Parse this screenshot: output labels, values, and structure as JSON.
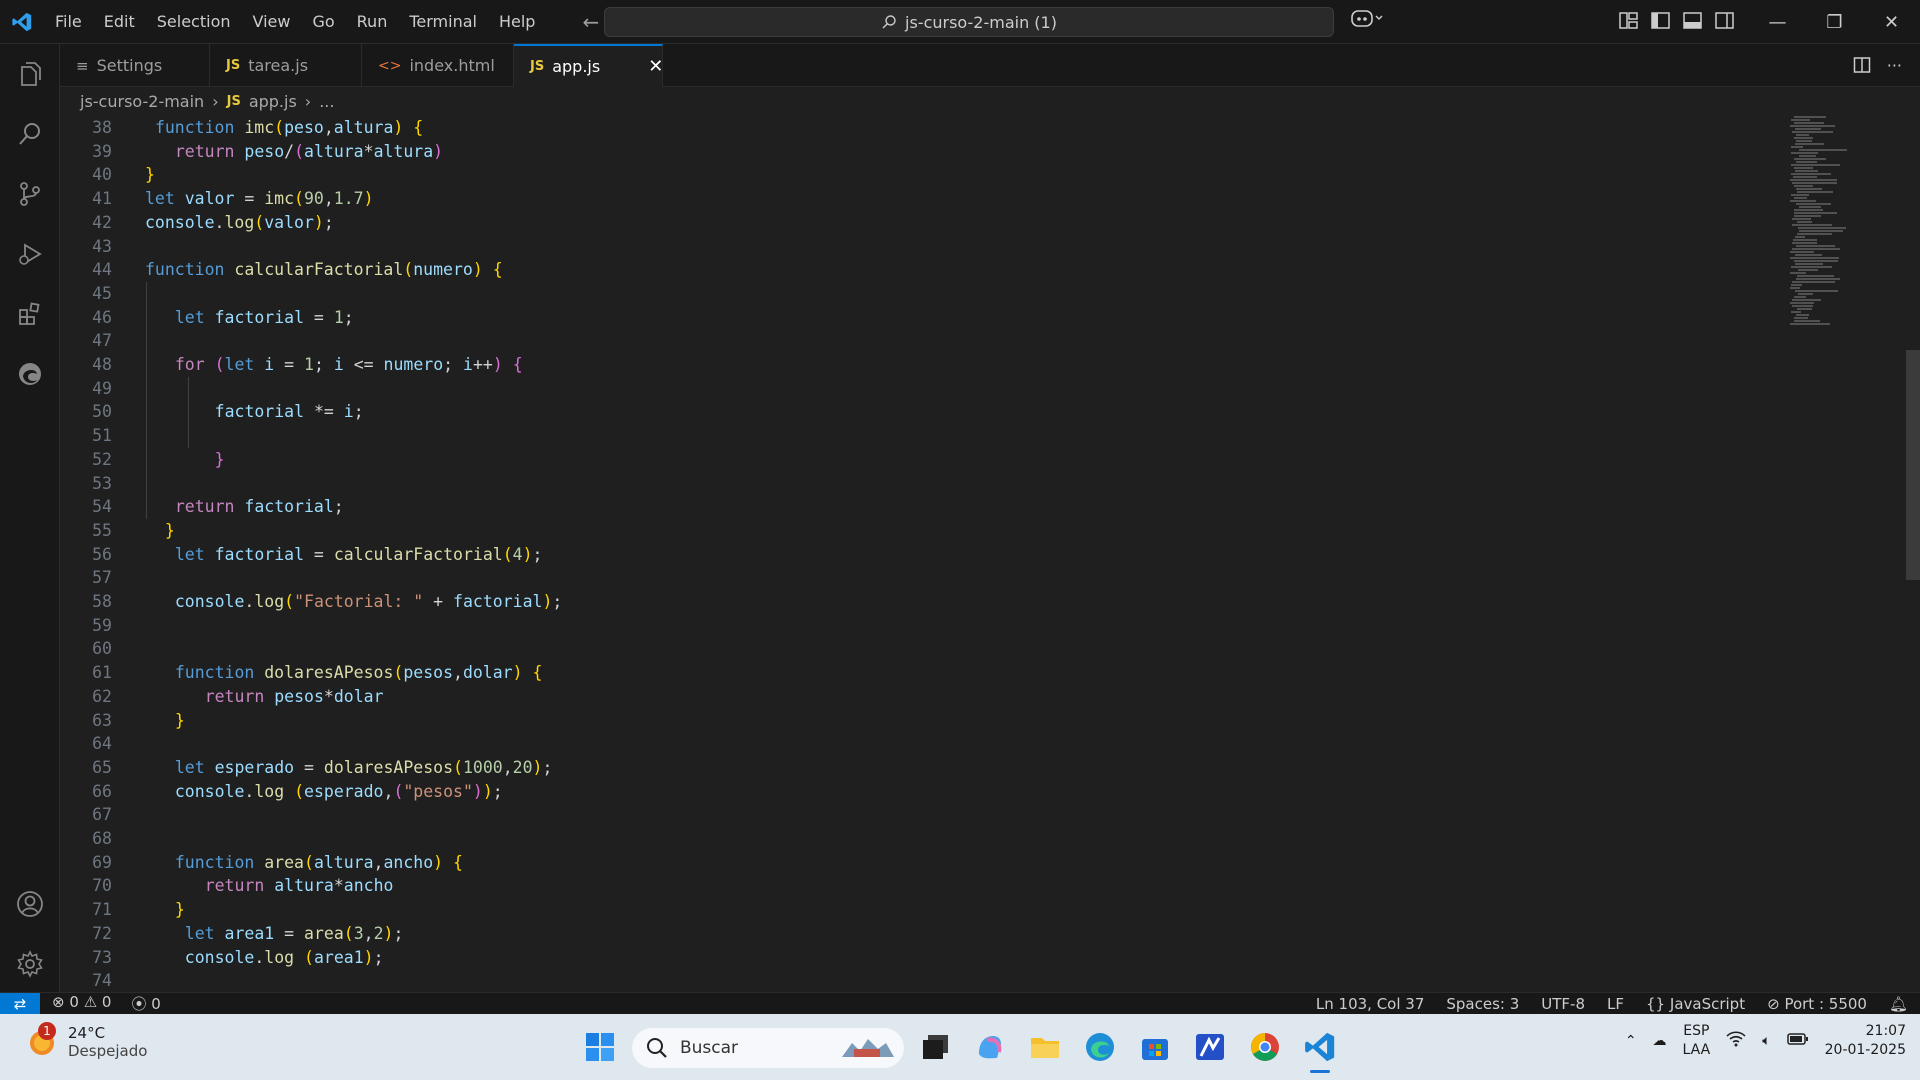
{
  "titlebar": {
    "menu": [
      "File",
      "Edit",
      "Selection",
      "View",
      "Go",
      "Run",
      "Terminal",
      "Help"
    ],
    "search": "js-curso-2-main (1)"
  },
  "tabs": [
    {
      "label": "Settings",
      "icon": "gear-icon"
    },
    {
      "label": "tarea.js",
      "icon": "js-icon"
    },
    {
      "label": "index.html",
      "icon": "html-icon"
    },
    {
      "label": "app.js",
      "icon": "js-icon",
      "active": true
    }
  ],
  "breadcrumb": {
    "folder": "js-curso-2-main",
    "file": "app.js",
    "rest": "..."
  },
  "editor": {
    "lines": [
      {
        "n": "38",
        "indent": 1,
        "tokens": [
          [
            "kw",
            "function "
          ],
          [
            "fn",
            "imc"
          ],
          [
            "p1",
            "("
          ],
          [
            "var",
            "peso"
          ],
          [
            "op",
            ","
          ],
          [
            "var",
            "altura"
          ],
          [
            "p1",
            ")"
          ],
          [
            "op",
            " "
          ],
          [
            "p1",
            "{"
          ]
        ]
      },
      {
        "n": "39",
        "indent": 3,
        "tokens": [
          [
            "ctl",
            "return "
          ],
          [
            "var",
            "peso"
          ],
          [
            "op",
            "/"
          ],
          [
            "p2",
            "("
          ],
          [
            "var",
            "altura"
          ],
          [
            "op",
            "*"
          ],
          [
            "var",
            "altura"
          ],
          [
            "p2",
            ")"
          ]
        ]
      },
      {
        "n": "40",
        "indent": 0,
        "tokens": [
          [
            "p1",
            "}"
          ]
        ]
      },
      {
        "n": "41",
        "indent": 0,
        "tokens": [
          [
            "kw",
            "let "
          ],
          [
            "var",
            "valor"
          ],
          [
            "op",
            " = "
          ],
          [
            "fn",
            "imc"
          ],
          [
            "p1",
            "("
          ],
          [
            "num",
            "90"
          ],
          [
            "op",
            ","
          ],
          [
            "num",
            "1.7"
          ],
          [
            "p1",
            ")"
          ]
        ]
      },
      {
        "n": "42",
        "indent": 0,
        "tokens": [
          [
            "var",
            "console"
          ],
          [
            "op",
            "."
          ],
          [
            "fn",
            "log"
          ],
          [
            "p1",
            "("
          ],
          [
            "var",
            "valor"
          ],
          [
            "p1",
            ")"
          ],
          [
            "op",
            ";"
          ]
        ]
      },
      {
        "n": "43",
        "indent": 0,
        "tokens": []
      },
      {
        "n": "44",
        "indent": 0,
        "tokens": [
          [
            "kw",
            "function "
          ],
          [
            "fn",
            "calcularFactorial"
          ],
          [
            "p1",
            "("
          ],
          [
            "var",
            "numero"
          ],
          [
            "p1",
            ")"
          ],
          [
            "op",
            " "
          ],
          [
            "p1",
            "{"
          ]
        ]
      },
      {
        "n": "45",
        "indent": 0,
        "tokens": []
      },
      {
        "n": "46",
        "indent": 3,
        "tokens": [
          [
            "kw",
            "let "
          ],
          [
            "var",
            "factorial"
          ],
          [
            "op",
            " = "
          ],
          [
            "num",
            "1"
          ],
          [
            "op",
            ";"
          ]
        ]
      },
      {
        "n": "47",
        "indent": 0,
        "tokens": []
      },
      {
        "n": "48",
        "indent": 3,
        "tokens": [
          [
            "ctl",
            "for "
          ],
          [
            "p2",
            "("
          ],
          [
            "kw",
            "let "
          ],
          [
            "var",
            "i"
          ],
          [
            "op",
            " = "
          ],
          [
            "num",
            "1"
          ],
          [
            "op",
            "; "
          ],
          [
            "var",
            "i"
          ],
          [
            "op",
            " <= "
          ],
          [
            "var",
            "numero"
          ],
          [
            "op",
            "; "
          ],
          [
            "var",
            "i"
          ],
          [
            "op",
            "++"
          ],
          [
            "p2",
            ")"
          ],
          [
            "op",
            " "
          ],
          [
            "p2",
            "{"
          ]
        ]
      },
      {
        "n": "49",
        "indent": 0,
        "tokens": []
      },
      {
        "n": "50",
        "indent": 7,
        "tokens": [
          [
            "var",
            "factorial"
          ],
          [
            "op",
            " *= "
          ],
          [
            "var",
            "i"
          ],
          [
            "op",
            ";"
          ]
        ]
      },
      {
        "n": "51",
        "indent": 0,
        "tokens": []
      },
      {
        "n": "52",
        "indent": 7,
        "tokens": [
          [
            "p2",
            "}"
          ]
        ]
      },
      {
        "n": "53",
        "indent": 0,
        "tokens": []
      },
      {
        "n": "54",
        "indent": 3,
        "tokens": [
          [
            "ctl",
            "return "
          ],
          [
            "var",
            "factorial"
          ],
          [
            "op",
            ";"
          ]
        ]
      },
      {
        "n": "55",
        "indent": 2,
        "tokens": [
          [
            "p1",
            "}"
          ]
        ]
      },
      {
        "n": "56",
        "indent": 3,
        "tokens": [
          [
            "kw",
            "let "
          ],
          [
            "var",
            "factorial"
          ],
          [
            "op",
            " = "
          ],
          [
            "fn",
            "calcularFactorial"
          ],
          [
            "p1",
            "("
          ],
          [
            "num",
            "4"
          ],
          [
            "p1",
            ")"
          ],
          [
            "op",
            ";"
          ]
        ]
      },
      {
        "n": "57",
        "indent": 0,
        "tokens": []
      },
      {
        "n": "58",
        "indent": 3,
        "tokens": [
          [
            "var",
            "console"
          ],
          [
            "op",
            "."
          ],
          [
            "fn",
            "log"
          ],
          [
            "p1",
            "("
          ],
          [
            "str",
            "\"Factorial: \""
          ],
          [
            "op",
            " + "
          ],
          [
            "var",
            "factorial"
          ],
          [
            "p1",
            ")"
          ],
          [
            "op",
            ";"
          ]
        ]
      },
      {
        "n": "59",
        "indent": 0,
        "tokens": []
      },
      {
        "n": "60",
        "indent": 0,
        "tokens": []
      },
      {
        "n": "61",
        "indent": 3,
        "tokens": [
          [
            "kw",
            "function "
          ],
          [
            "fn",
            "dolaresAPesos"
          ],
          [
            "p1",
            "("
          ],
          [
            "var",
            "pesos"
          ],
          [
            "op",
            ","
          ],
          [
            "var",
            "dolar"
          ],
          [
            "p1",
            ")"
          ],
          [
            "op",
            " "
          ],
          [
            "p1",
            "{"
          ]
        ]
      },
      {
        "n": "62",
        "indent": 6,
        "tokens": [
          [
            "ctl",
            "return "
          ],
          [
            "var",
            "pesos"
          ],
          [
            "op",
            "*"
          ],
          [
            "var",
            "dolar"
          ]
        ]
      },
      {
        "n": "63",
        "indent": 3,
        "tokens": [
          [
            "p1",
            "}"
          ]
        ]
      },
      {
        "n": "64",
        "indent": 0,
        "tokens": []
      },
      {
        "n": "65",
        "indent": 3,
        "tokens": [
          [
            "kw",
            "let "
          ],
          [
            "var",
            "esperado"
          ],
          [
            "op",
            " = "
          ],
          [
            "fn",
            "dolaresAPesos"
          ],
          [
            "p1",
            "("
          ],
          [
            "num",
            "1000"
          ],
          [
            "op",
            ","
          ],
          [
            "num",
            "20"
          ],
          [
            "p1",
            ")"
          ],
          [
            "op",
            ";"
          ]
        ]
      },
      {
        "n": "66",
        "indent": 3,
        "tokens": [
          [
            "var",
            "console"
          ],
          [
            "op",
            "."
          ],
          [
            "fn",
            "log"
          ],
          [
            "op",
            " "
          ],
          [
            "p1",
            "("
          ],
          [
            "var",
            "esperado"
          ],
          [
            "op",
            ","
          ],
          [
            "p2",
            "("
          ],
          [
            "str",
            "\"pesos\""
          ],
          [
            "p2",
            ")"
          ],
          [
            "p1",
            ")"
          ],
          [
            "op",
            ";"
          ]
        ]
      },
      {
        "n": "67",
        "indent": 0,
        "tokens": []
      },
      {
        "n": "68",
        "indent": 0,
        "tokens": []
      },
      {
        "n": "69",
        "indent": 3,
        "tokens": [
          [
            "kw",
            "function "
          ],
          [
            "fn",
            "area"
          ],
          [
            "p1",
            "("
          ],
          [
            "var",
            "altura"
          ],
          [
            "op",
            ","
          ],
          [
            "var",
            "ancho"
          ],
          [
            "p1",
            ")"
          ],
          [
            "op",
            " "
          ],
          [
            "p1",
            "{"
          ]
        ]
      },
      {
        "n": "70",
        "indent": 6,
        "tokens": [
          [
            "ctl",
            "return "
          ],
          [
            "var",
            "altura"
          ],
          [
            "op",
            "*"
          ],
          [
            "var",
            "ancho"
          ]
        ]
      },
      {
        "n": "71",
        "indent": 3,
        "tokens": [
          [
            "p1",
            "}"
          ]
        ]
      },
      {
        "n": "72",
        "indent": 4,
        "tokens": [
          [
            "kw",
            "let "
          ],
          [
            "var",
            "area1"
          ],
          [
            "op",
            " = "
          ],
          [
            "fn",
            "area"
          ],
          [
            "p1",
            "("
          ],
          [
            "num",
            "3"
          ],
          [
            "op",
            ","
          ],
          [
            "num",
            "2"
          ],
          [
            "p1",
            ")"
          ],
          [
            "op",
            ";"
          ]
        ]
      },
      {
        "n": "73",
        "indent": 4,
        "tokens": [
          [
            "var",
            "console"
          ],
          [
            "op",
            "."
          ],
          [
            "fn",
            "log"
          ],
          [
            "op",
            " "
          ],
          [
            "p1",
            "("
          ],
          [
            "var",
            "area1"
          ],
          [
            "p1",
            ")"
          ],
          [
            "op",
            ";"
          ]
        ]
      },
      {
        "n": "74",
        "indent": 0,
        "tokens": []
      }
    ]
  },
  "statusbar": {
    "errors": "0",
    "warnings": "0",
    "ports": "0",
    "position": "Ln 103, Col 37",
    "spaces": "Spaces: 3",
    "encoding": "UTF-8",
    "eol": "LF",
    "language": "JavaScript",
    "port": "Port : 5500"
  },
  "taskbar": {
    "weather_temp": "24°C",
    "weather_cond": "Despejado",
    "weather_badge": "1",
    "search_placeholder": "Buscar",
    "lang_top": "ESP",
    "lang_bottom": "LAA",
    "time": "21:07",
    "date": "20-01-2025"
  },
  "colors": {
    "accent": "#0078d4",
    "editor_bg": "#1f1f1f"
  }
}
